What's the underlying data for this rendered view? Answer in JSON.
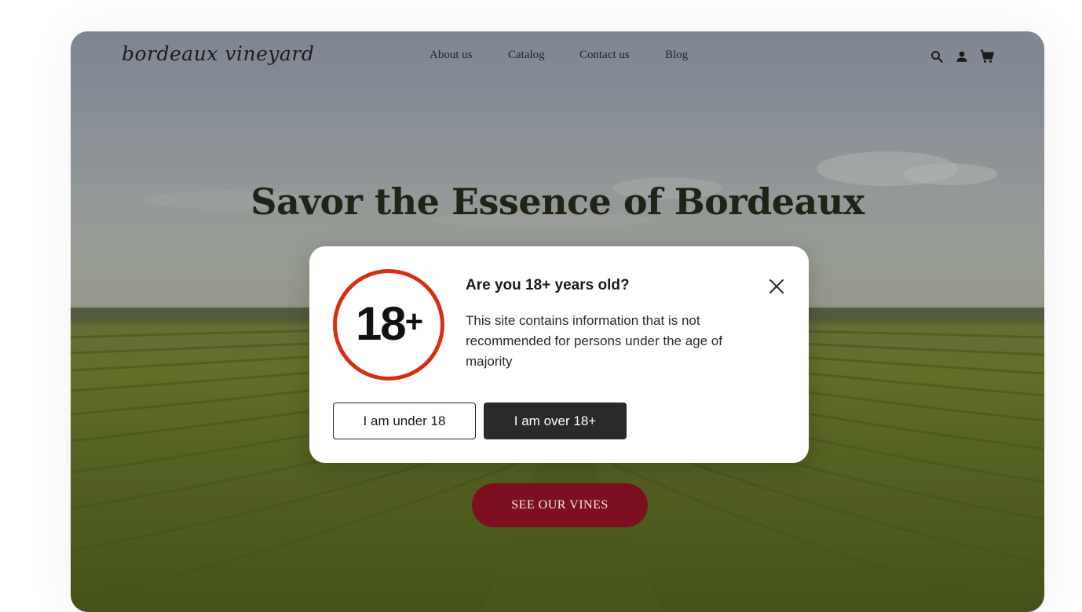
{
  "brand": {
    "logo": "bordeaux vineyard"
  },
  "nav": {
    "items": [
      {
        "label": "About us"
      },
      {
        "label": "Catalog"
      },
      {
        "label": "Contact us"
      },
      {
        "label": "Blog"
      }
    ],
    "icons": [
      "search-icon",
      "user-icon",
      "cart-icon"
    ]
  },
  "hero": {
    "title": "Savor the Essence of Bordeaux",
    "cta_label": "SEE OUR VINES"
  },
  "age_modal": {
    "badge": "18",
    "badge_suffix": "+",
    "title": "Are you 18+ years old?",
    "body": "This site contains information that is not recommended for persons under the age of majority",
    "under_label": "I am under 18",
    "over_label": "I am over 18+"
  },
  "colors": {
    "accent": "#7d1020",
    "badge_ring": "#d62e14",
    "primary_button": "#2a2a2a"
  }
}
